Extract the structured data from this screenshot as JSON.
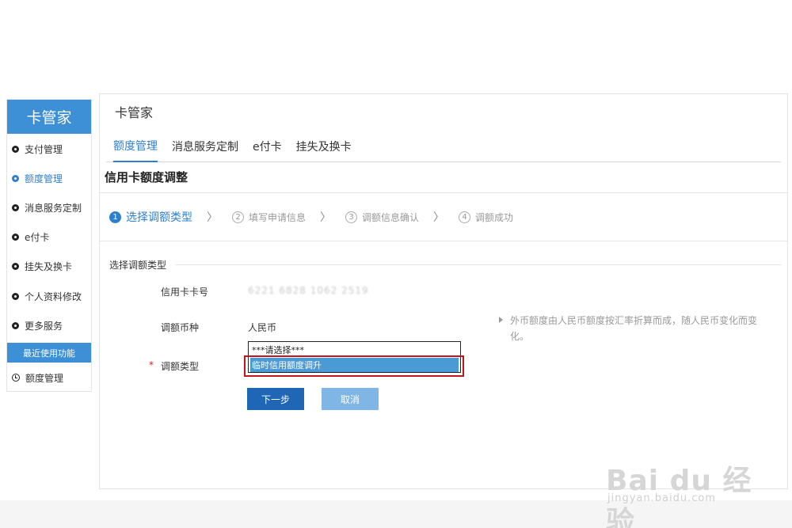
{
  "sidebar": {
    "title": "卡管家",
    "items": [
      {
        "label": "支付管理"
      },
      {
        "label": "额度管理",
        "active": true
      },
      {
        "label": "消息服务定制"
      },
      {
        "label": "e付卡"
      },
      {
        "label": "挂失及换卡"
      },
      {
        "label": "个人资料修改"
      },
      {
        "label": "更多服务"
      }
    ],
    "recent_heading": "最近使用功能",
    "recent_item": "额度管理"
  },
  "main": {
    "title": "卡管家",
    "tabs": [
      {
        "label": "额度管理",
        "active": true
      },
      {
        "label": "消息服务定制"
      },
      {
        "label": "e付卡"
      },
      {
        "label": "挂失及换卡"
      }
    ],
    "section_title": "信用卡额度调整",
    "steps": [
      {
        "num": "1",
        "label": "选择调额类型",
        "active": true
      },
      {
        "num": "2",
        "label": "填写申请信息"
      },
      {
        "num": "3",
        "label": "调额信息确认"
      },
      {
        "num": "4",
        "label": "调额成功"
      }
    ],
    "step_separator": "〉",
    "form": {
      "group_title": "选择调额类型",
      "card_label": "信用卡卡号",
      "card_value": "6221 6828 1062 2519",
      "currency_label": "调额币种",
      "currency_value": "人民币",
      "required_mark": "*",
      "type_label": "调额类型",
      "type_options": [
        "***请选择***",
        "临时信用额度调升"
      ],
      "hint": "外币额度由人民币额度按汇率折算而成，随人民币变化而变化。"
    },
    "buttons": {
      "next": "下一步",
      "cancel": "取消"
    }
  },
  "watermark": {
    "brand": "Bai du 经验",
    "url": "jingyan.baidu.com"
  },
  "colors": {
    "accent": "#3d8fd6",
    "primary_button": "#1f67b5",
    "secondary_button": "#7fb6e6",
    "highlight": "#c0161c"
  }
}
